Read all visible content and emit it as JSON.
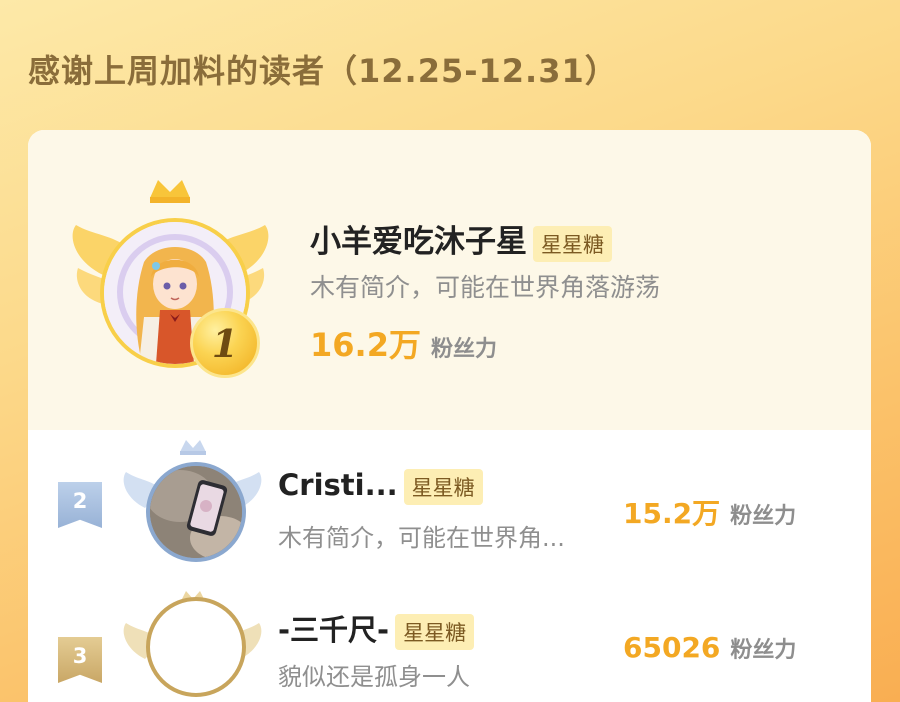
{
  "header": {
    "title": "感谢上周加料的读者（12.25-12.31）"
  },
  "colors": {
    "accent_gold": "#f3a823",
    "tag_bg": "#fdeeb4",
    "silver": "#98b2d6",
    "bronze": "#c9a766"
  },
  "ranking": [
    {
      "rank": "1",
      "name": "小羊爱吃沐子星",
      "tag": "星星糖",
      "bio": "木有简介，可能在世界角落游荡",
      "fans_value": "16.2万",
      "fans_unit": "粉丝力",
      "medal": "gold-crown-icon"
    },
    {
      "rank": "2",
      "name": "Cristi...",
      "tag": "星星糖",
      "bio": "木有简介，可能在世界角...",
      "fans_value": "15.2万",
      "fans_unit": "粉丝力",
      "medal": "silver-crown-icon"
    },
    {
      "rank": "3",
      "name": "-三千尺-",
      "tag": "星星糖",
      "bio": "貌似还是孤身一人",
      "fans_value": "65026",
      "fans_unit": "粉丝力",
      "medal": "bronze-crown-icon"
    }
  ]
}
